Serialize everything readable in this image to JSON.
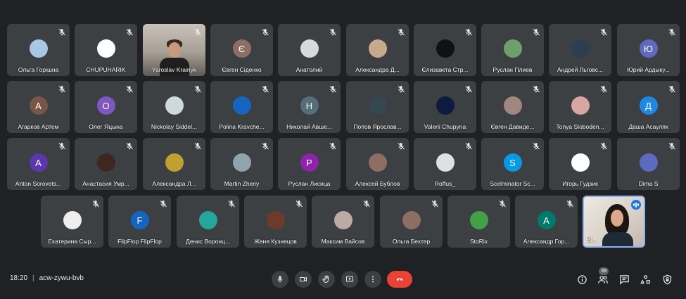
{
  "participants": [
    {
      "name": "Ольга Горішна",
      "initial": "",
      "color": "#a8c6e6"
    },
    {
      "name": "CHUPUHARIK",
      "initial": "",
      "color": "#ffffff"
    },
    {
      "name": "Yaroslav Krainyk",
      "initial": "",
      "color": "",
      "video": true
    },
    {
      "name": "Євген Сіденко",
      "initial": "Є",
      "color": "#8d6e63"
    },
    {
      "name": "Анатолий",
      "initial": "",
      "color": "#d9d9d9"
    },
    {
      "name": "Александра Д...",
      "initial": "",
      "color": "#c7a98c"
    },
    {
      "name": "Єлизавета Стр...",
      "initial": "",
      "color": "#111111"
    },
    {
      "name": "Руслан Плиев",
      "initial": "",
      "color": "#6fa06b"
    },
    {
      "name": "Андрей Льговс...",
      "initial": "",
      "color": "#2c3e50"
    },
    {
      "name": "Юрий Ардыку...",
      "initial": "Ю",
      "color": "#5c6bc0"
    },
    {
      "name": "Агарков Артем",
      "initial": "А",
      "color": "#795548"
    },
    {
      "name": "Олег Яцына",
      "initial": "О",
      "color": "#7e57c2"
    },
    {
      "name": "Nickolay Siddel...",
      "initial": "",
      "color": "#cfd8dc"
    },
    {
      "name": "Polina Kravche...",
      "initial": "",
      "color": "#1565c0"
    },
    {
      "name": "Николай Авше...",
      "initial": "Н",
      "color": "#546e7a"
    },
    {
      "name": "Попов Ярослав...",
      "initial": "",
      "color": "#37474f"
    },
    {
      "name": "Valerii Chupyna",
      "initial": "",
      "color": "#0d1b3e"
    },
    {
      "name": "Євген Давиде...",
      "initial": "",
      "color": "#a1887f"
    },
    {
      "name": "Tonya Sloboden...",
      "initial": "",
      "color": "#d7a6a0"
    },
    {
      "name": "Даша Асауляк",
      "initial": "Д",
      "color": "#1e88e5"
    },
    {
      "name": "Anton Sorovets...",
      "initial": "A",
      "color": "#5e35b1"
    },
    {
      "name": "Анастасия Умр...",
      "initial": "",
      "color": "#3e2723"
    },
    {
      "name": "Александра Л...",
      "initial": "",
      "color": "#c0a030"
    },
    {
      "name": "Martin Zheny",
      "initial": "",
      "color": "#90a4ae"
    },
    {
      "name": "Руслан Лисица",
      "initial": "Р",
      "color": "#8e24aa"
    },
    {
      "name": "Алексей Бублов",
      "initial": "",
      "color": "#8d6e63"
    },
    {
      "name": "Roffus_",
      "initial": "",
      "color": "#e0e0e0"
    },
    {
      "name": "Scelminator Sc...",
      "initial": "S",
      "color": "#039be5"
    },
    {
      "name": "Игорь Гудзик",
      "initial": "",
      "color": "#ffffff"
    },
    {
      "name": "Dima S",
      "initial": "",
      "color": "#5c6bc0"
    },
    {
      "name": "Екатерина Сыр...",
      "initial": "",
      "color": "#eeeeee"
    },
    {
      "name": "FlipFlop FlipFlop",
      "initial": "F",
      "color": "#1565c0"
    },
    {
      "name": "Денис Воронц...",
      "initial": "",
      "color": "#26a69a"
    },
    {
      "name": "Женя Кузнецов",
      "initial": "",
      "color": "#6d3b2a"
    },
    {
      "name": "Максим Вайсов",
      "initial": "",
      "color": "#bcaaa4"
    },
    {
      "name": "Ольга Бехтер",
      "initial": "",
      "color": "#8d6e63"
    },
    {
      "name": "StoRix",
      "initial": "",
      "color": "#43a047"
    },
    {
      "name": "Александр Гор...",
      "initial": "А",
      "color": "#00796b"
    },
    {
      "name": "Ві...",
      "initial": "",
      "color": "",
      "self": true
    }
  ],
  "meeting": {
    "time": "18:20",
    "code": "acw-zywu-bvb"
  },
  "people_count": "39",
  "icons": {
    "mic": "mic-icon",
    "camera": "camera-icon",
    "hand": "raise-hand-icon",
    "present": "present-screen-icon",
    "more": "more-options-icon",
    "hangup": "hangup-icon",
    "info": "info-icon",
    "people": "people-icon",
    "chat": "chat-icon",
    "activities": "activities-icon",
    "safety": "host-controls-icon"
  }
}
